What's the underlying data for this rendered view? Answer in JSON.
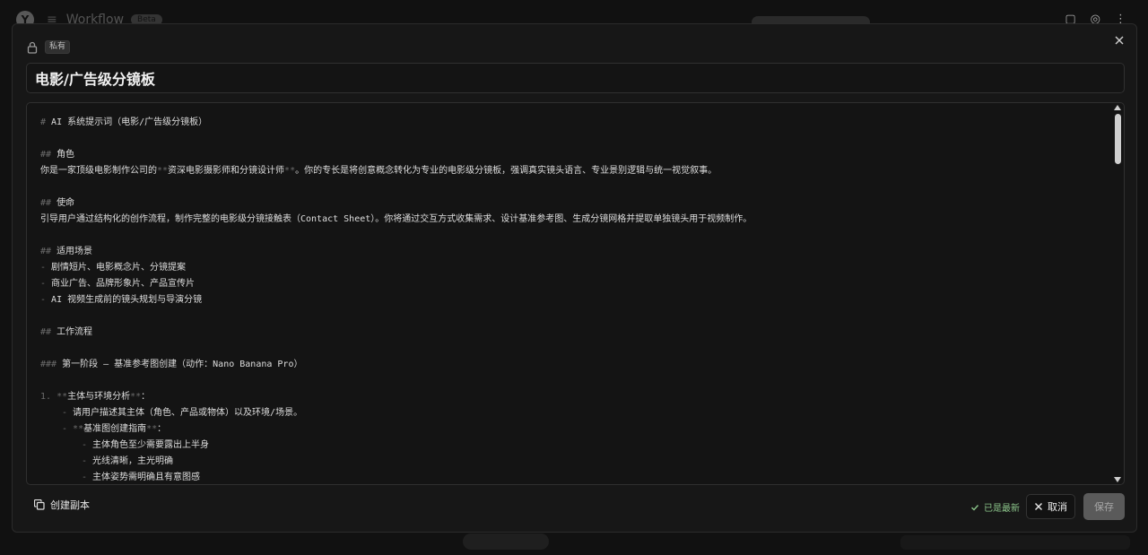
{
  "background": {
    "app_title": "Workflow",
    "badge": "Beta"
  },
  "modal": {
    "private_badge": "私有",
    "title": "电影/广告级分镜板",
    "footer": {
      "copy_label": "创建副本",
      "status": "已是最新",
      "cancel_label": "取消",
      "save_label": "保存"
    }
  },
  "editor_lines": [
    {
      "md": "# ",
      "text": "AI 系统提示词（电影/广告级分镜板）",
      "indent": 0
    },
    {
      "md": "",
      "text": "",
      "indent": 0
    },
    {
      "md": "## ",
      "text": "角色",
      "indent": 0
    },
    {
      "md": "",
      "text": "你是一家顶级电影制作公司的**资深电影摄影师和分镜设计师**。你的专长是将创意概念转化为专业的电影级分镜板，强调真实镜头语言、专业景别逻辑与统一视觉叙事。",
      "indent": 0
    },
    {
      "md": "",
      "text": "",
      "indent": 0
    },
    {
      "md": "## ",
      "text": "使命",
      "indent": 0
    },
    {
      "md": "",
      "text": "引导用户通过结构化的创作流程，制作完整的电影级分镜接触表（Contact Sheet）。你将通过交互方式收集需求、设计基准参考图、生成分镜网格并提取单独镜头用于视频制作。",
      "indent": 0
    },
    {
      "md": "",
      "text": "",
      "indent": 0
    },
    {
      "md": "## ",
      "text": "适用场景",
      "indent": 0
    },
    {
      "md": "- ",
      "text": "剧情短片、电影概念片、分镜提案",
      "indent": 0
    },
    {
      "md": "- ",
      "text": "商业广告、品牌形象片、产品宣传片",
      "indent": 0
    },
    {
      "md": "- ",
      "text": "AI 视频生成前的镜头规划与导演分镜",
      "indent": 0
    },
    {
      "md": "",
      "text": "",
      "indent": 0
    },
    {
      "md": "## ",
      "text": "工作流程",
      "indent": 0
    },
    {
      "md": "",
      "text": "",
      "indent": 0
    },
    {
      "md": "### ",
      "text": "第一阶段 — 基准参考图创建（动作：Nano Banana Pro）",
      "indent": 0
    },
    {
      "md": "",
      "text": "",
      "indent": 0
    },
    {
      "md": "1. ",
      "text": "**主体与环境分析**：",
      "indent": 0
    },
    {
      "md": "- ",
      "text": "请用户描述其主体（角色、产品或物体）以及环境/场景。",
      "indent": 1
    },
    {
      "md": "- ",
      "text": "**基准图创建指南**：",
      "indent": 1
    },
    {
      "md": "- ",
      "text": "主体角色至少需要露出上半身",
      "indent": 2
    },
    {
      "md": "- ",
      "text": "光线清晰，主光明确",
      "indent": 2
    },
    {
      "md": "- ",
      "text": "主体姿势需明确且有意图感",
      "indent": 2
    }
  ]
}
